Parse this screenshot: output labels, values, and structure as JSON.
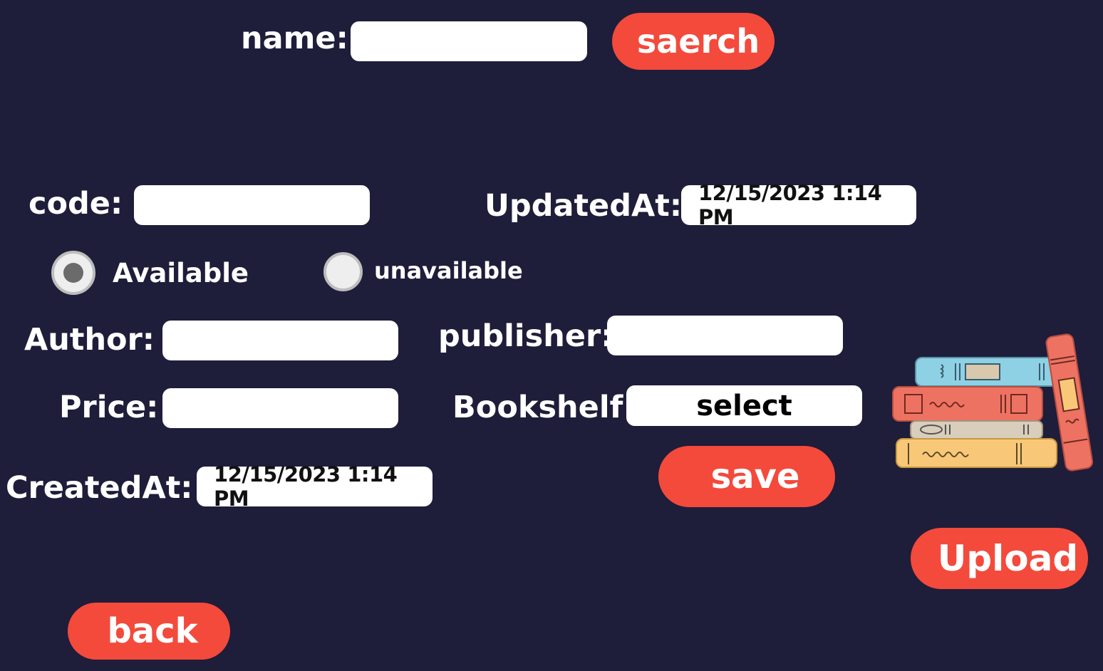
{
  "search": {
    "label": "name:",
    "value": "",
    "button": "saerch"
  },
  "form": {
    "code_label": "code:",
    "code_value": "",
    "updated_label": "UpdatedAt:",
    "updated_value": "12/15/2023 1:14 PM",
    "status": {
      "available_label": "Available",
      "unavailable_label": "unavailable",
      "selected": "Available"
    },
    "author_label": "Author:",
    "author_value": "",
    "publisher_label": "publisher:",
    "publisher_value": "",
    "price_label": "Price:",
    "price_value": "",
    "bookshelf_label": "Bookshelf:",
    "bookshelf_value": "select",
    "created_label": "CreatedAt:",
    "created_value": "12/15/2023 1:14 PM"
  },
  "actions": {
    "save": "save",
    "upload": "Upload",
    "back": "back"
  },
  "colors": {
    "background": "#1e1d3a",
    "accent": "#f34a3c",
    "field": "#ffffff"
  },
  "icons": {
    "illustration": "books-stack-icon"
  }
}
